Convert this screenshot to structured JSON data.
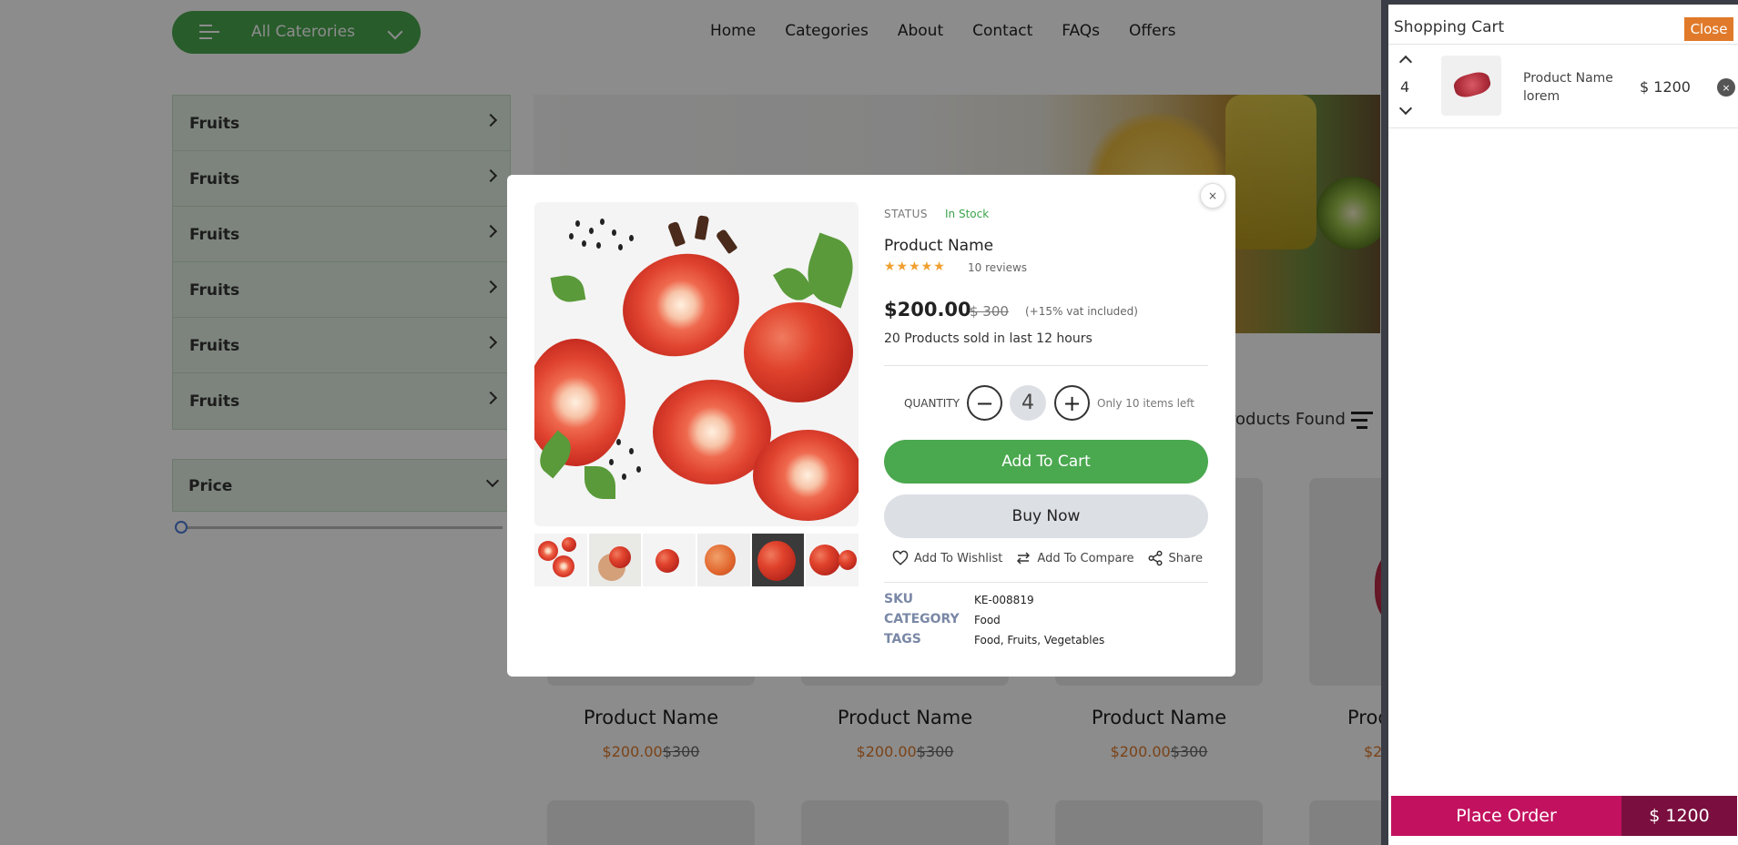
{
  "header": {
    "category_button": "All Caterories",
    "nav": [
      "Home",
      "Categories",
      "About",
      "Contact",
      "FAQs",
      "Offers"
    ]
  },
  "sidebar": {
    "items": [
      "Fruits",
      "Fruits",
      "Fruits",
      "Fruits",
      "Fruits",
      "Fruits"
    ],
    "price_label": "Price",
    "price_slider_value": 0
  },
  "listing": {
    "found_text": "roducts Found",
    "products": [
      {
        "name": "Product Name",
        "price": "$200.00",
        "old_price": "$300"
      },
      {
        "name": "Product Name",
        "price": "$200.00",
        "old_price": "$300"
      },
      {
        "name": "Product Name",
        "price": "$200.00",
        "old_price": "$300"
      },
      {
        "name": "Prod",
        "price": "$2",
        "old_price": ""
      }
    ]
  },
  "modal": {
    "close_symbol": "×",
    "status_label": "STATUS",
    "status_value": "In Stock",
    "title": "Product Name",
    "stars": "★★★★★",
    "rating": 5,
    "reviews": "10 reviews",
    "price": "$200.00",
    "old_price": "$ 300",
    "vat_note": "(+15% vat included)",
    "sold_note": "20 Products sold in last 12 hours",
    "quantity_label": "QUANTITY",
    "quantity_minus": "−",
    "quantity_value": "4",
    "quantity_plus": "+",
    "stock_note": "Only 10 items left",
    "add_to_cart": "Add To Cart",
    "buy_now": "Buy Now",
    "actions": {
      "wishlist": "Add To Wishlist",
      "compare": "Add To Compare",
      "share": "Share"
    },
    "meta": {
      "sku_label": "SKU",
      "sku_value": "KE-008819",
      "category_label": "CATEGORY",
      "category_value": "Food",
      "tags_label": "TAGS",
      "tags_value": "Food, Fruits, Vegetables"
    },
    "thumbnail_count": 6
  },
  "cart": {
    "title": "Shopping Cart",
    "close_label": "Close",
    "items": [
      {
        "quantity": "4",
        "name": "Product Name lorem",
        "price": "$ 1200",
        "remove_symbol": "×"
      }
    ],
    "place_order": "Place Order",
    "total": "$ 1200"
  },
  "colors": {
    "brand_green": "#4aa84f",
    "accent_orange": "#e07a2a",
    "order_magenta": "#c2125f",
    "order_dark": "#7a0f3f",
    "in_stock": "#3aa34a"
  }
}
